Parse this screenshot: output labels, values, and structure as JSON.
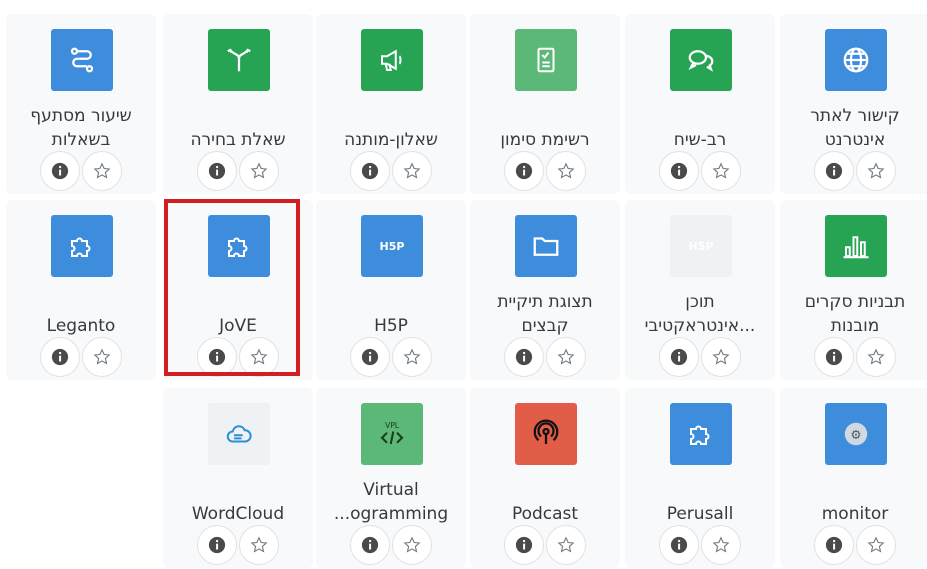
{
  "colors": {
    "blue": "#3d8ddc",
    "green": "#27a453",
    "light_green": "#5cb877",
    "red": "#e25d47",
    "grey_tile": "#eef2f5",
    "highlight": "#d21e23"
  },
  "rows": [
    [
      {
        "label": "קישור לאתר אינטרנט",
        "icon": "globe-icon",
        "color": "blue"
      },
      {
        "label": "רב-שיח",
        "icon": "chat-icon",
        "color": "green"
      },
      {
        "label": "רשימת סימון",
        "icon": "checklist-icon",
        "color": "light_green"
      },
      {
        "label": "שאלון-מותנה",
        "icon": "megaphone-icon",
        "color": "green"
      },
      {
        "label": "שאלת בחירה",
        "icon": "fork-icon",
        "color": "green"
      },
      {
        "label": "שיעור מסתעף בשאלות",
        "icon": "branch-path-icon",
        "color": "blue"
      }
    ],
    [
      {
        "label": "תבניות סקרים מובנות",
        "icon": "bar-chart-icon",
        "color": "green"
      },
      {
        "label": "תוכן אינטראקטיבי...",
        "icon": "h5p-icon",
        "color": "grey_tile"
      },
      {
        "label": "תצוגת תיקיית קבצים",
        "icon": "folder-icon",
        "color": "blue"
      },
      {
        "label": "H5P",
        "icon": "h5p-icon",
        "color": "blue"
      },
      {
        "label": "JoVE",
        "icon": "puzzle-icon",
        "color": "blue"
      },
      {
        "label": "Leganto",
        "icon": "puzzle-icon",
        "color": "blue"
      }
    ],
    [
      {
        "label": "monitor",
        "icon": "monitor-icon",
        "color": "blue"
      },
      {
        "label": "Perusall",
        "icon": "puzzle-icon",
        "color": "blue"
      },
      {
        "label": "Podcast",
        "icon": "podcast-icon",
        "color": "red"
      },
      {
        "label": "Virtual ...ogramming",
        "icon": "vpl-icon",
        "color": "light_green"
      },
      {
        "label": "WordCloud",
        "icon": "cloud-icon",
        "color": "grey_tile"
      }
    ]
  ]
}
